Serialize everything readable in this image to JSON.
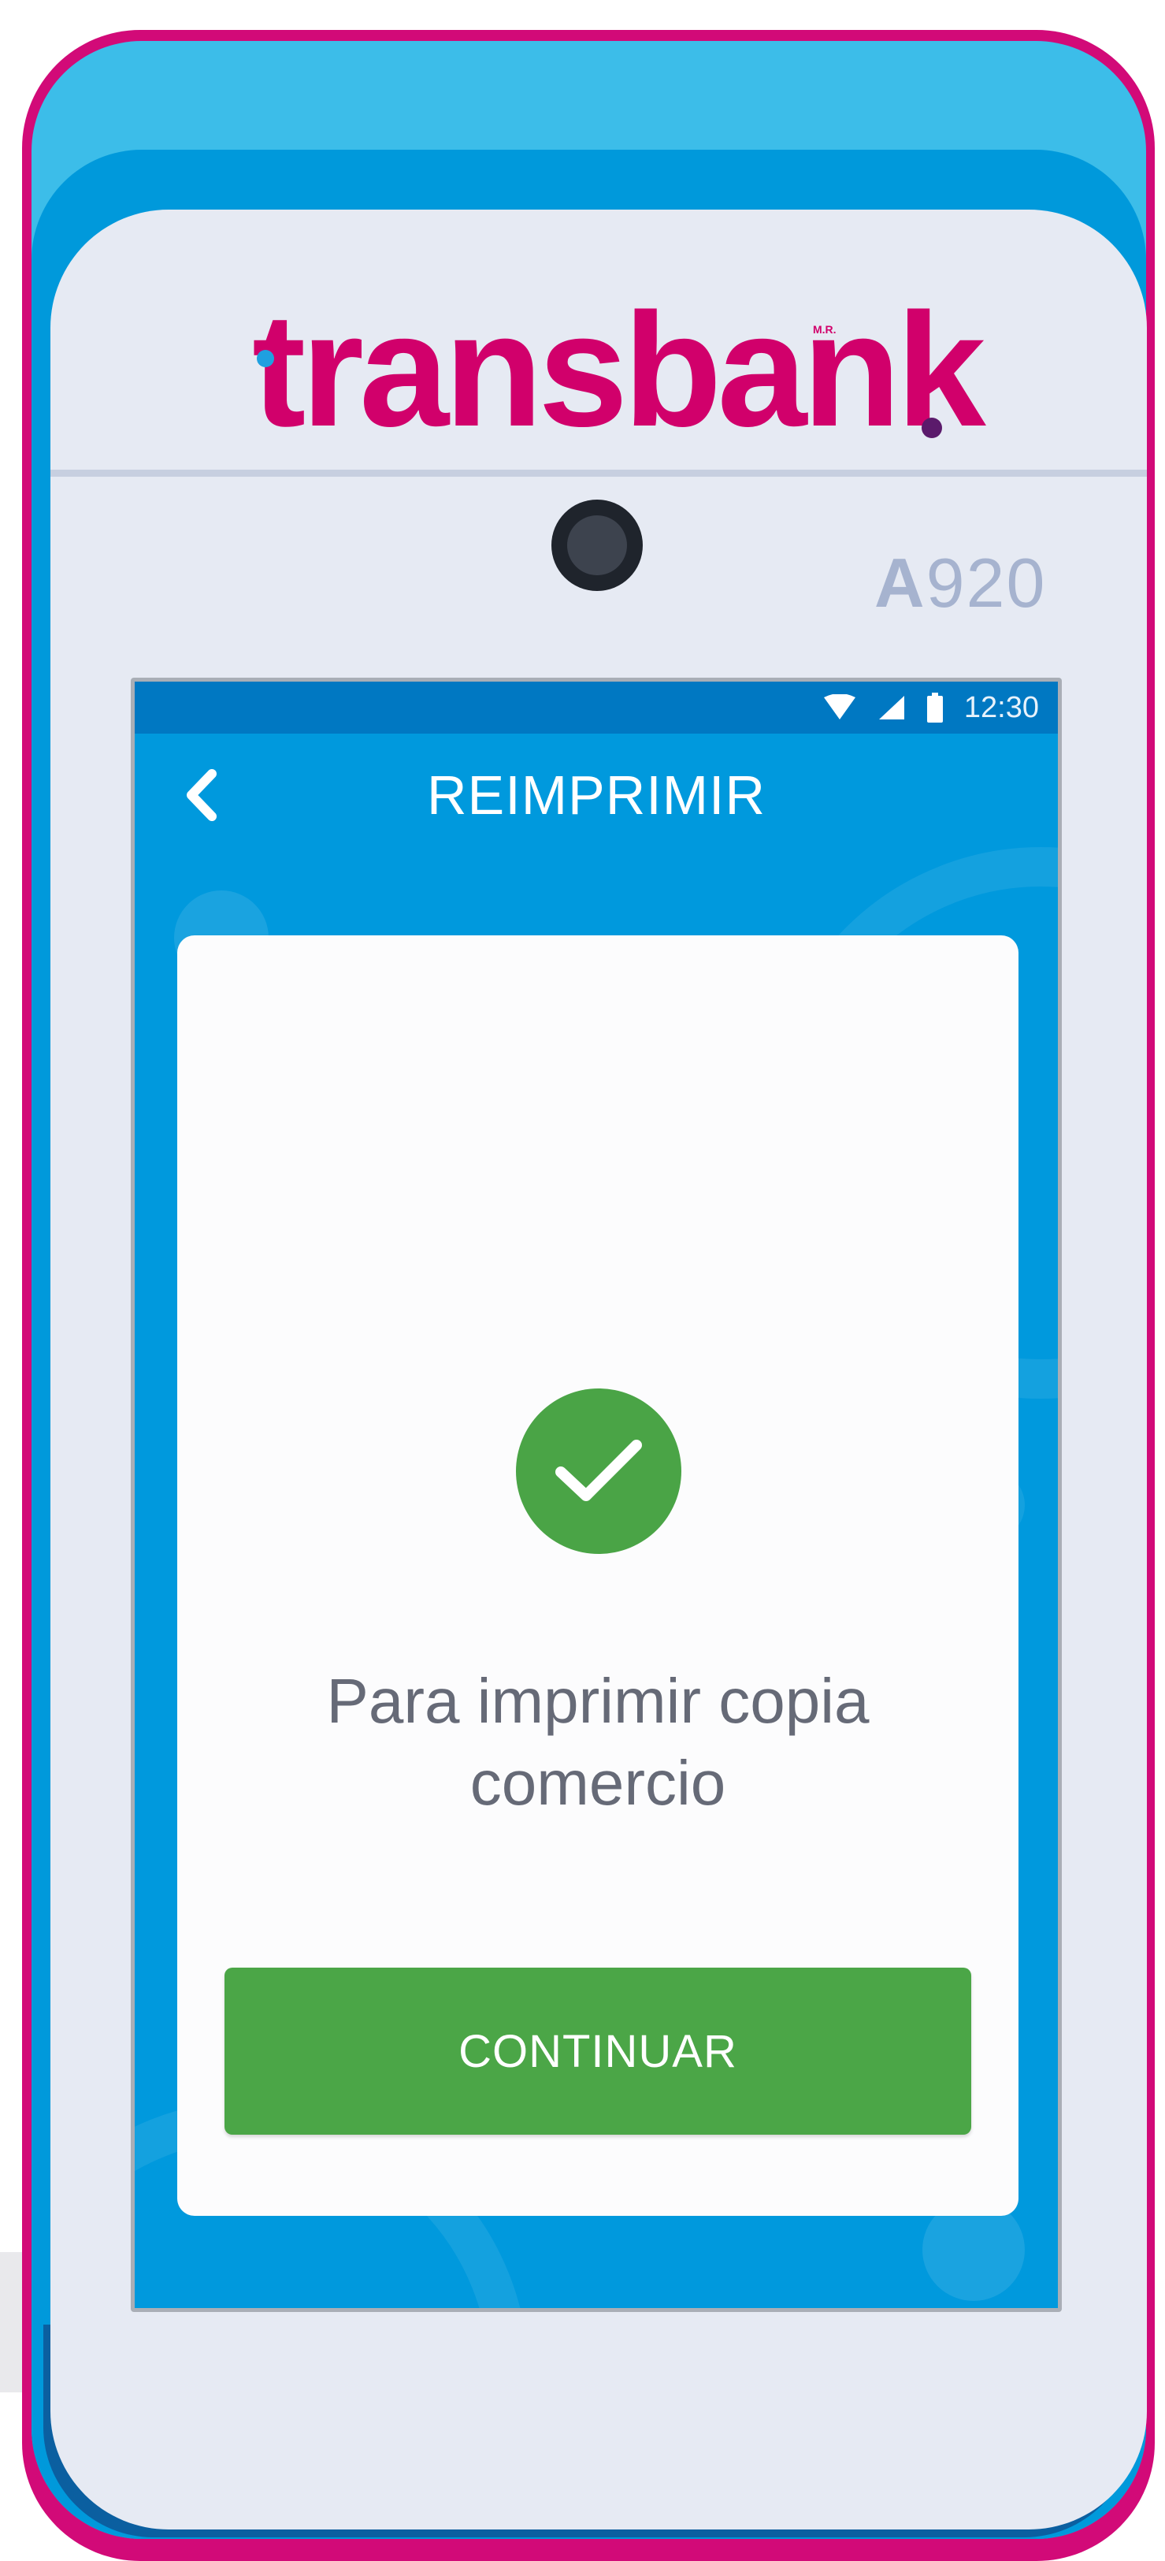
{
  "brand": {
    "logo_text": "transbank",
    "logo_mark": "M.R.",
    "model_prefix": "A",
    "model_number": "920",
    "colors": {
      "brand_magenta": "#d1006b",
      "device_blue": "#0099db",
      "success_green": "#4ba647"
    }
  },
  "status_bar": {
    "icons": [
      "wifi-icon",
      "cell-signal-icon",
      "battery-icon"
    ],
    "time": "12:30"
  },
  "app_bar": {
    "back_icon": "chevron-left-icon",
    "title": "REIMPRIMIR"
  },
  "card": {
    "status_icon": "check-circle-icon",
    "message": "Para imprimir copia comercio",
    "button_label": "CONTINUAR"
  }
}
